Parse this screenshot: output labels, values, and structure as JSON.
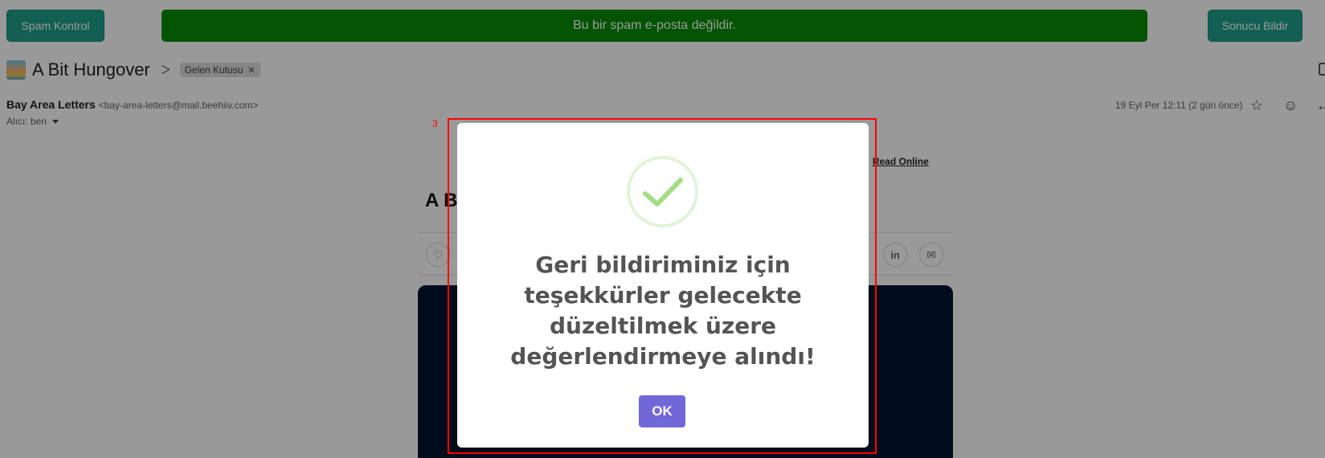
{
  "toolbar": {
    "spam_check_label": "Spam Kontrol",
    "status_message": "Bu bir spam e-posta değildir.",
    "report_label": "Sonucu Bildir"
  },
  "email": {
    "subject": "A Bit Hungover",
    "label": "Gelen Kutusu",
    "sender_name": "Bay Area Letters",
    "sender_email": "<bay-area-letters@mail.beehiiv.com>",
    "recipient": "Alıcı: ben",
    "date": "19 Eyl Per 12:11 (2 gün önce)"
  },
  "content": {
    "link_fragment": "e",
    "separator": "|",
    "read_online": "Read Online",
    "title_fragment": "A B",
    "linkedin": "in"
  },
  "annotation": {
    "number": "3"
  },
  "modal": {
    "message": "Geri bildiriminiz için teşekkürler gelecekte düzeltilmek üzere değerlendirmeye alındı!",
    "ok_label": "OK"
  },
  "colors": {
    "teal_button": "#1fa08c",
    "status_green": "#048d04",
    "ok_purple": "#7267d9",
    "check_green": "#a5dc86",
    "annotation_red": "#ff0000"
  }
}
